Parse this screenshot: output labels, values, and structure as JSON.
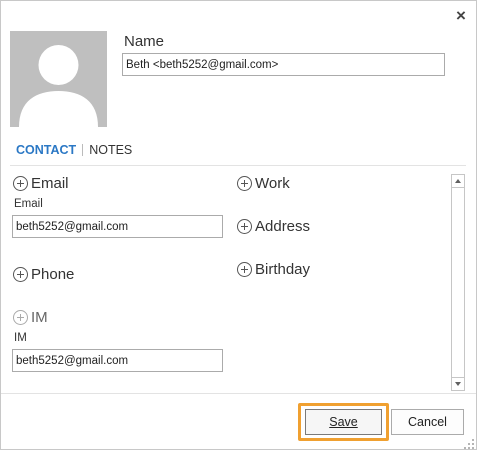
{
  "dialog": {
    "close_glyph": "×",
    "name_label": "Name",
    "name_value": "Beth <beth5252@gmail.com>",
    "tabs": [
      {
        "label": "CONTACT",
        "active": true
      },
      {
        "label": "NOTES",
        "active": false
      }
    ],
    "left_fields": {
      "email": {
        "header": "Email",
        "sub_label": "Email",
        "value": "beth5252@gmail.com"
      },
      "phone": {
        "header": "Phone"
      },
      "im": {
        "header": "IM",
        "sub_label": "IM",
        "value": "beth5252@gmail.com"
      }
    },
    "right_fields": {
      "work": "Work",
      "address": "Address",
      "birthday": "Birthday"
    },
    "buttons": {
      "save": "Save",
      "cancel": "Cancel"
    },
    "colors": {
      "accent": "#2b78c5",
      "highlight": "#f0a030",
      "avatar_bg": "#bfbfbf"
    }
  }
}
